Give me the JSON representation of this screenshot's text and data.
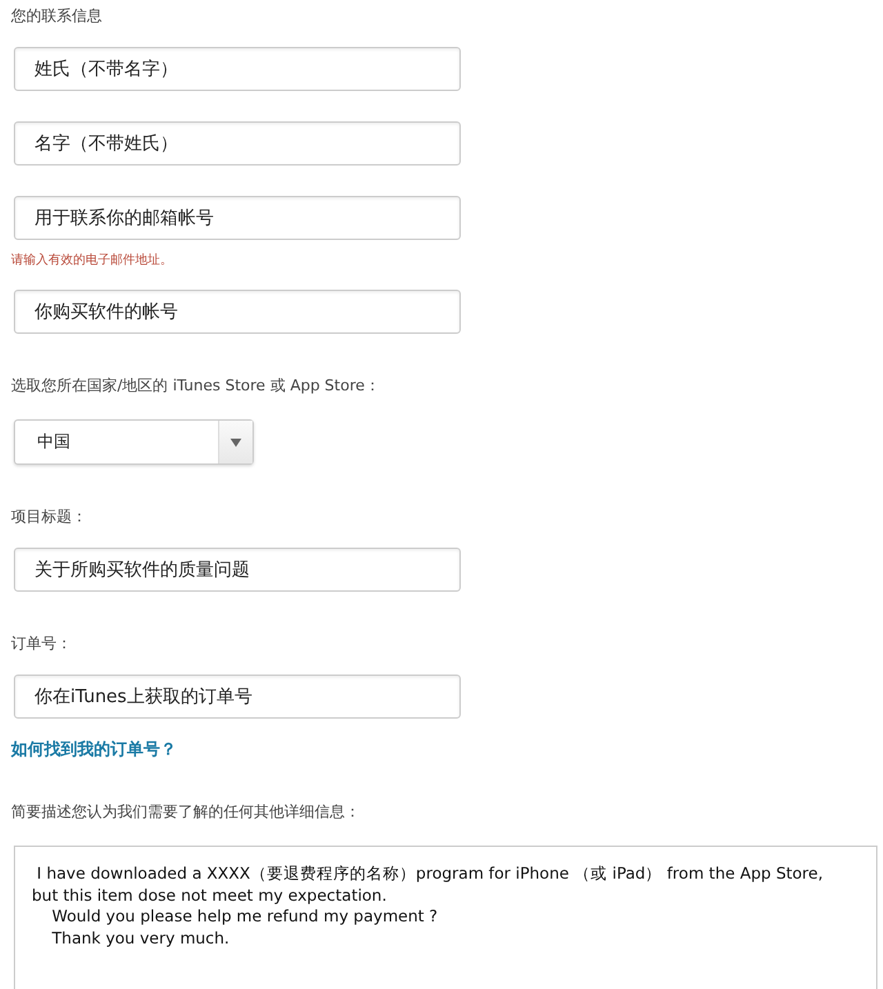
{
  "items": [
    {
      "kind": "label",
      "text": "您的联系信息"
    },
    {
      "kind": "field",
      "value": "姓氏（不带名字）"
    },
    {
      "kind": "field",
      "value": "名字（不带姓氏）"
    },
    {
      "kind": "field",
      "value": "用于联系你的邮箱帐号"
    },
    {
      "kind": "error",
      "text": "请输入有效的电子邮件地址。"
    },
    {
      "kind": "field",
      "value": "你购买软件的帐号"
    },
    {
      "kind": "label",
      "text": "选取您所在国家/地区的 iTunes Store 或 App Store："
    },
    {
      "kind": "select",
      "value": "中国"
    },
    {
      "kind": "label",
      "text": "项目标题："
    },
    {
      "kind": "field",
      "value": "关于所购买软件的质量问题"
    },
    {
      "kind": "label",
      "text": "订单号："
    },
    {
      "kind": "field",
      "value": "你在iTunes上获取的订单号"
    },
    {
      "kind": "link",
      "text": "如何找到我的订单号？"
    },
    {
      "kind": "label",
      "text": "简要描述您认为我们需要了解的任何其他详细信息："
    },
    {
      "kind": "textarea",
      "value": " I have downloaded a XXXX（要退费程序的名称）program for iPhone （或 iPad） from the App Store,\nbut this item dose not meet my expectation.\n    Would you please help me refund my payment ?\n    Thank you very much."
    }
  ]
}
